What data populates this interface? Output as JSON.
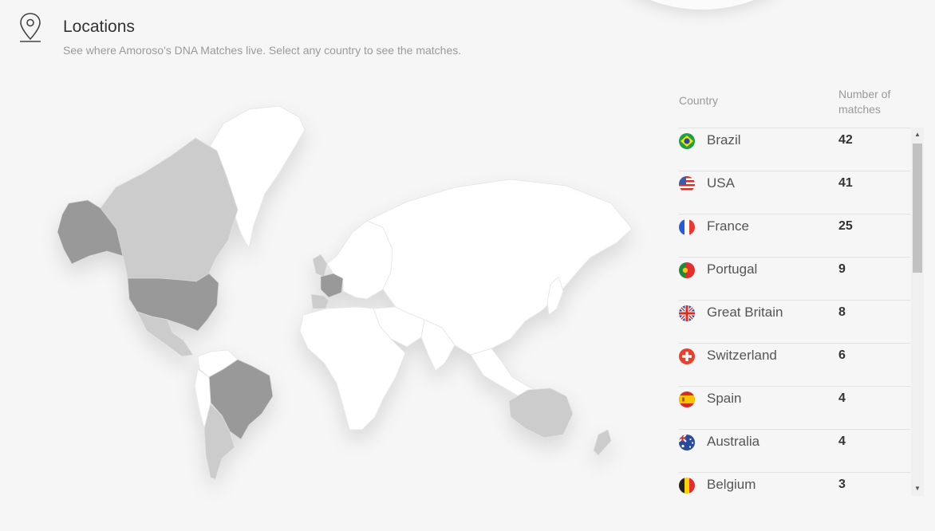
{
  "header": {
    "title": "Locations",
    "subtitle": "See where Amoroso's DNA Matches live. Select any country to see the matches."
  },
  "table": {
    "col_country": "Country",
    "col_matches": "Number of matches",
    "rows": [
      {
        "country": "Brazil",
        "count": "42"
      },
      {
        "country": "USA",
        "count": "41"
      },
      {
        "country": "France",
        "count": "25"
      },
      {
        "country": "Portugal",
        "count": "9"
      },
      {
        "country": "Great Britain",
        "count": "8"
      },
      {
        "country": "Switzerland",
        "count": "6"
      },
      {
        "country": "Spain",
        "count": "4"
      },
      {
        "country": "Australia",
        "count": "4"
      },
      {
        "country": "Belgium",
        "count": "3"
      }
    ]
  },
  "colors": {
    "background": "#f6f6f6",
    "land": "#ffffff",
    "land_few_matches": "#cccccc",
    "land_many_matches": "#999999"
  }
}
